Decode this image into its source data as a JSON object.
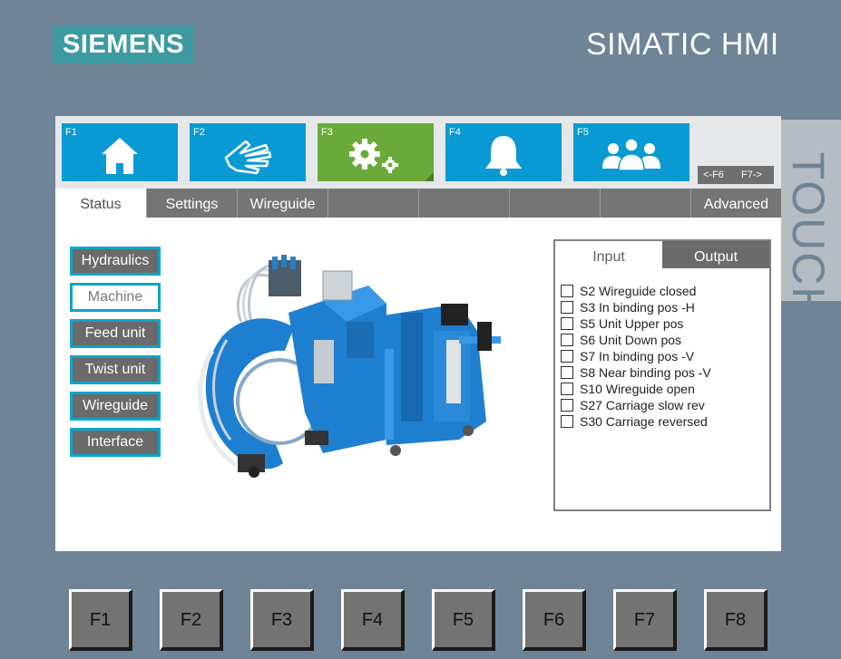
{
  "brand": {
    "logo": "SIEMENS",
    "title": "SIMATIC HMI",
    "side_label": "TOUCH"
  },
  "function_keys": [
    {
      "label": "F1",
      "icon": "home-icon",
      "color": "#0a9ad3"
    },
    {
      "label": "F2",
      "icon": "hand-icon",
      "color": "#0a9ad3"
    },
    {
      "label": "F3",
      "icon": "gears-icon",
      "color": "#6aaa3a"
    },
    {
      "label": "F4",
      "icon": "bell-icon",
      "color": "#0a9ad3"
    },
    {
      "label": "F5",
      "icon": "users-icon",
      "color": "#0a9ad3"
    }
  ],
  "nav": {
    "prev": "<-F6",
    "next": "F7->"
  },
  "tabs": [
    "Status",
    "Settings",
    "Wireguide",
    "",
    "",
    "",
    "",
    "Advanced"
  ],
  "side_buttons": [
    "Hydraulics",
    "Machine",
    "Feed unit",
    "Twist unit",
    "Wireguide",
    "Interface"
  ],
  "io_panel": {
    "tab_input": "Input",
    "tab_output": "Output",
    "inputs": [
      "S2  Wireguide closed",
      "S3  In binding pos  -H",
      "S5  Unit Upper pos",
      "S6  Unit Down pos",
      "S7  In binding pos -V",
      "S8  Near binding pos -V",
      "S10 Wireguide open",
      "S27 Carriage slow rev",
      "S30 Carriage reversed"
    ]
  },
  "hardware_keys": [
    "F1",
    "F2",
    "F3",
    "F4",
    "F5",
    "F6",
    "F7",
    "F8"
  ],
  "colors": {
    "accent_blue": "#0a9ad3",
    "accent_green": "#6aaa3a",
    "brand_teal": "#3d9aa0",
    "machine_blue": "#1e7fd0"
  }
}
